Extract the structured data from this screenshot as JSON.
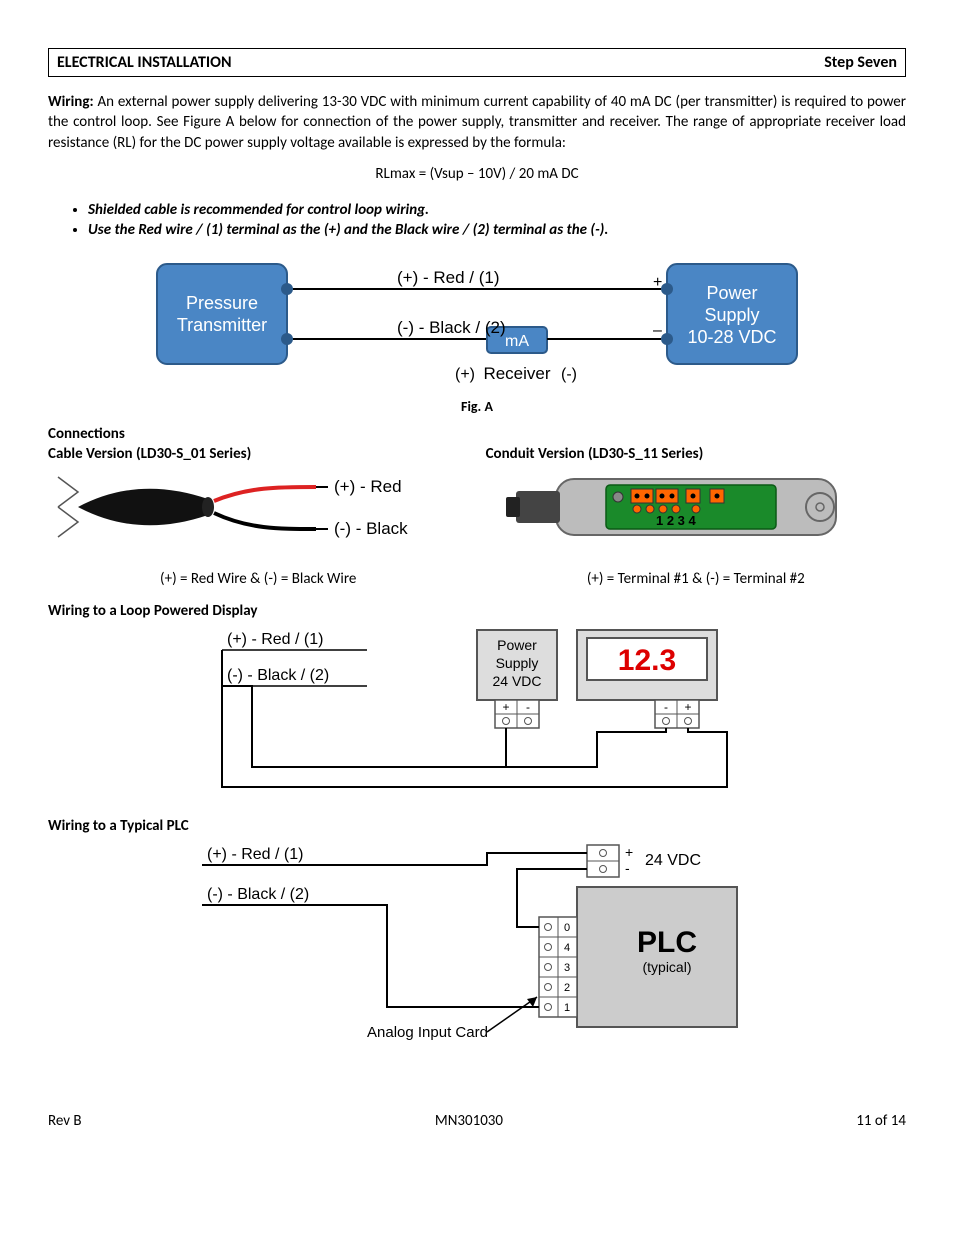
{
  "header": {
    "left": "ELECTRICAL INSTALLATION",
    "right": "Step Seven"
  },
  "wiring_label": "Wiring:",
  "wiring_text": "  An external power supply delivering 13-30 VDC with minimum current capability of 40 mA DC (per transmitter) is required to power the control loop.  See Figure A below for connection of the power supply, transmitter and receiver.  The range of appropriate receiver load resistance (RL) for the DC power supply voltage available is expressed by the formula:",
  "formula": "RLmax = (Vsup – 10V) / 20 mA DC",
  "bullets": [
    "Shielded cable is recommended for control loop wiring.",
    "Use the Red wire / (1) terminal as the (+) and the Black wire / (2) terminal as the (-)."
  ],
  "figA": {
    "transmitter_l1": "Pressure",
    "transmitter_l2": "Transmitter",
    "wire_plus": "(+) - Red / (1)",
    "wire_minus": "(-) - Black / (2)",
    "mA": "mA",
    "receiver": "Receiver",
    "rx_plus": "(+)",
    "rx_minus": "(-)",
    "ps_l1": "Power",
    "ps_l2": "Supply",
    "ps_l3": "10-28 VDC",
    "ps_plus": "+",
    "ps_minus": "–",
    "caption": "Fig. A"
  },
  "connections_title": "Connections",
  "cable": {
    "title": "Cable Version (LD30-S_01 Series)",
    "plus": "(+) - Red",
    "minus": "(-) - Black",
    "legend": "(+) = Red Wire   &   (-) = Black Wire"
  },
  "conduit": {
    "title": "Conduit Version (LD30-S_11 Series)",
    "terms": "1 2 3 4",
    "legend": "(+) = Terminal #1   &   (-) = Terminal #2"
  },
  "loop": {
    "title": "Wiring to a Loop Powered Display",
    "plus": "(+) - Red / (1)",
    "minus": "(-) - Black / (2)",
    "ps_l1": "Power",
    "ps_l2": "Supply",
    "ps_l3": "24 VDC",
    "display": "12.3",
    "tplus": "+",
    "tminus": "-"
  },
  "plc": {
    "title": "Wiring to a Typical PLC",
    "plus": "(+) - Red / (1)",
    "minus": "(-) - Black / (2)",
    "volt": "24 VDC",
    "tplus": "+",
    "tminus": "-",
    "plc_l1": "PLC",
    "plc_l2": "(typical)",
    "aic": "Analog Input Card",
    "ch": [
      "0",
      "4",
      "3",
      "2",
      "1"
    ]
  },
  "footer": {
    "left": "Rev B",
    "center": "MN301030",
    "right": "11 of 14"
  }
}
